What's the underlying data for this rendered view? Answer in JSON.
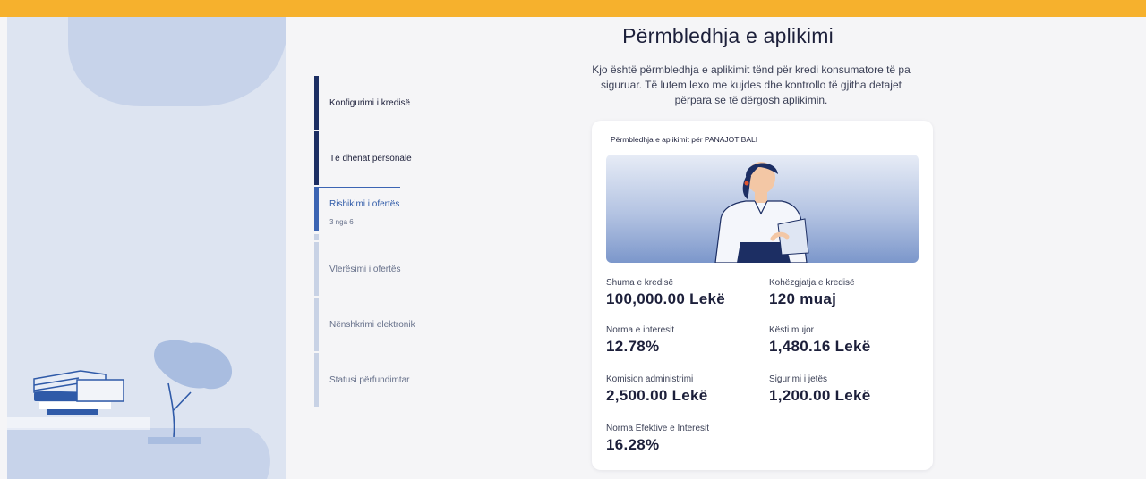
{
  "header": {
    "title": "Përmbledhja e aplikimi",
    "intro": "Kjo është përmbledhja e aplikimit tënd për kredi konsumatore të pa siguruar. Të lutem lexo me kujdes dhe kontrollo të gjitha detajet përpara se të dërgosh aplikimin."
  },
  "steps": [
    {
      "label": "Konfigurimi i kredisë",
      "state": "done"
    },
    {
      "label": "Të dhënat personale",
      "state": "done"
    },
    {
      "label": "Rishikimi i ofertës",
      "sub": "3 nga 6",
      "state": "current"
    },
    {
      "label": "Vlerësimi i ofertës",
      "state": "pending"
    },
    {
      "label": "Nënshkrimi elektronik",
      "state": "pending"
    },
    {
      "label": "Statusi përfundimtar",
      "state": "pending"
    }
  ],
  "summary": {
    "title": "Përmbledhja e aplikimit për PANAJOT BALI",
    "facts": [
      {
        "label": "Shuma e kredisë",
        "value": "100,000.00 Lekë"
      },
      {
        "label": "Kohëzgjatja e kredisë",
        "value": "120 muaj"
      },
      {
        "label": "Norma e interesit",
        "value": "12.78%"
      },
      {
        "label": "Kësti mujor",
        "value": "1,480.16 Lekë"
      },
      {
        "label": "Komision administrimi",
        "value": "2,500.00 Lekë"
      },
      {
        "label": "Sigurimi i jetës",
        "value": "1,200.00 Lekë"
      },
      {
        "label": "Norma Efektive e Interesit",
        "value": "16.28%"
      }
    ]
  },
  "colors": {
    "accent_bar": "#f6b12d",
    "step_done": "#1c2e63",
    "step_current": "#3b64b3",
    "step_pending": "#c8d2e5"
  }
}
